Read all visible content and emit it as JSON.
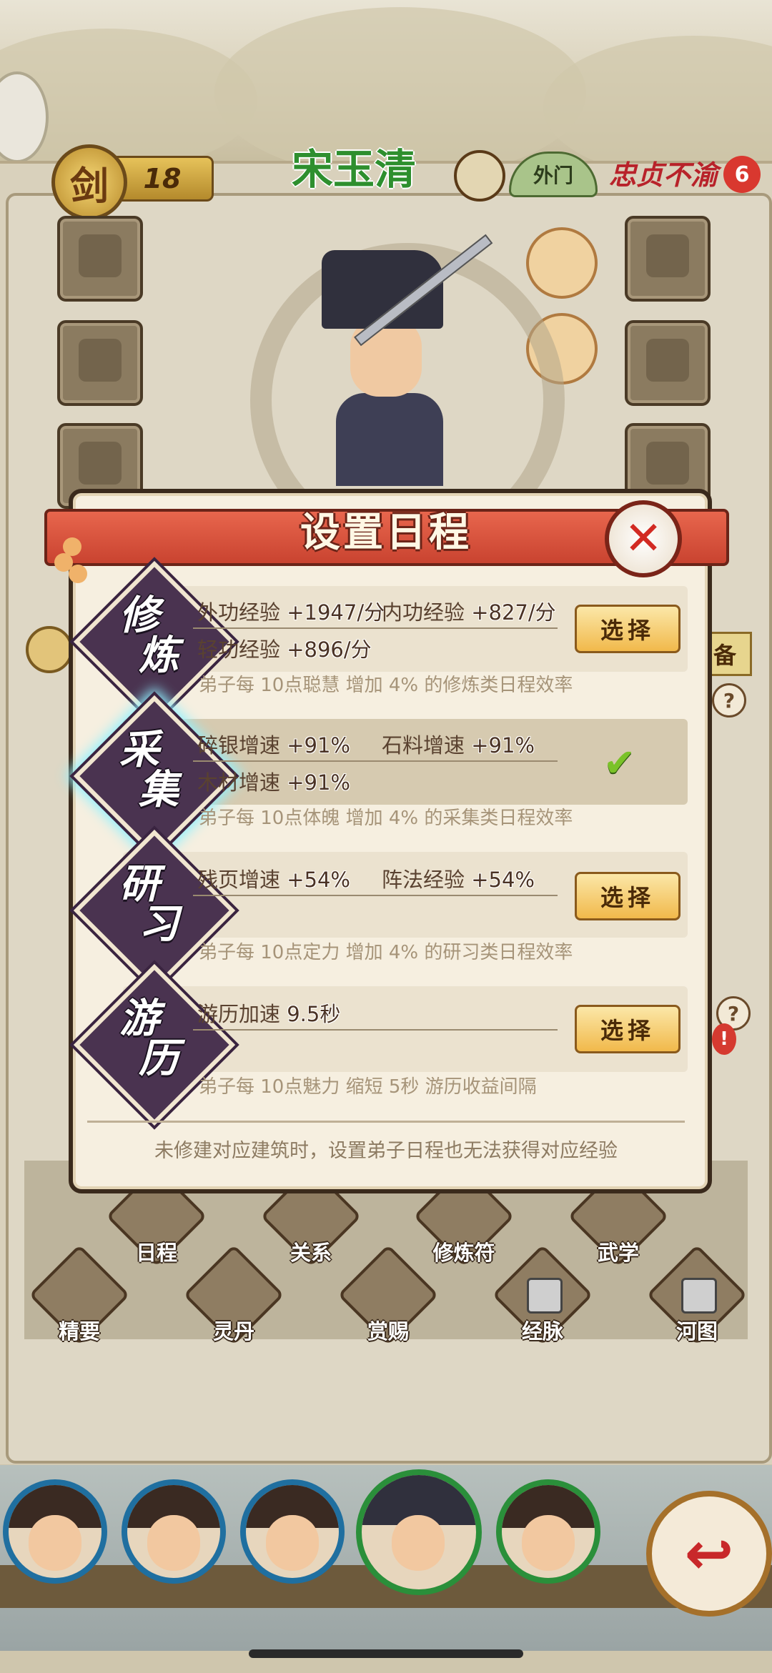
{
  "header": {
    "level": "18",
    "character_name": "宋玉清",
    "sect": "外门",
    "trait": "忠贞不渝",
    "trait_count": "6"
  },
  "dialog": {
    "title": "设置日程",
    "close_icon": "✕",
    "footer_note": "未修建对应建筑时，设置弟子日程也无法获得对应经验",
    "options": [
      {
        "badge": "修炼",
        "stats": [
          {
            "label": "外功经验",
            "value": "+1947/分"
          },
          {
            "label": "内功经验",
            "value": "+827/分"
          },
          {
            "label": "轻功经验",
            "value": "+896/分"
          }
        ],
        "hint": "弟子每 10点聪慧 增加 4% 的修炼类日程效率",
        "button_label": "选择",
        "selected": false
      },
      {
        "badge": "采集",
        "stats": [
          {
            "label": "碎银增速",
            "value": "+91%"
          },
          {
            "label": "石料增速",
            "value": "+91%"
          },
          {
            "label": "木材增速",
            "value": "+91%"
          }
        ],
        "hint": "弟子每 10点体魄 增加 4% 的采集类日程效率",
        "button_label": "",
        "selected": true
      },
      {
        "badge": "研习",
        "stats": [
          {
            "label": "残页增速",
            "value": "+54%"
          },
          {
            "label": "阵法经验",
            "value": "+54%"
          }
        ],
        "hint": "弟子每 10点定力 增加 4% 的研习类日程效率",
        "button_label": "选择",
        "selected": false
      },
      {
        "badge": "游历",
        "stats": [
          {
            "label": "游历加速",
            "value": "9.5秒"
          }
        ],
        "hint": "弟子每 10点魅力 缩短 5秒 游历收益间隔",
        "button_label": "选择",
        "selected": false
      }
    ]
  },
  "side": {
    "equip_tab": "备",
    "help": "?",
    "alert": "!"
  },
  "menu": {
    "row1": [
      "日程",
      "关系",
      "修炼符",
      "武学"
    ],
    "row2": [
      "精要",
      "灵丹",
      "赏赐",
      "经脉",
      "河图"
    ]
  },
  "roster": {
    "back_icon": "↩"
  },
  "colors": {
    "name_green": "#2e8f2e",
    "banner_red": "#c94330",
    "select_gold": "#f1b94b",
    "check_green": "#7ac228",
    "badge_purple": "#4a3350"
  }
}
